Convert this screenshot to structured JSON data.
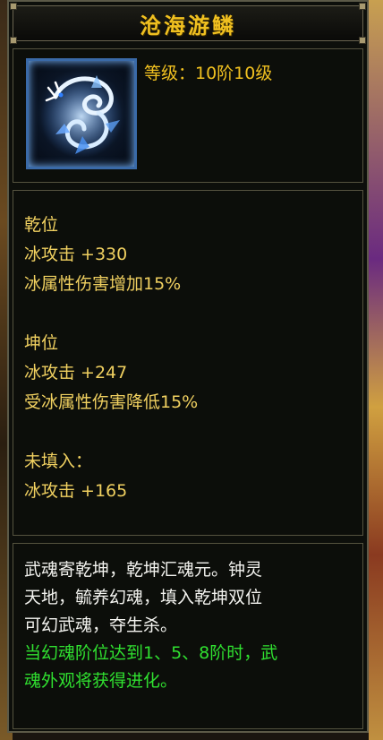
{
  "item": {
    "name": "沧海游鳞",
    "level_label": "等级：10阶10级",
    "icon": "ice-dragon-icon"
  },
  "stats": {
    "qian": {
      "heading": "乾位",
      "lines": [
        "冰攻击 +330",
        "冰属性伤害增加15%"
      ]
    },
    "kun": {
      "heading": "坤位",
      "lines": [
        "冰攻击 +247",
        "受冰属性伤害降低15%"
      ]
    },
    "unfilled": {
      "heading": "未填入：",
      "lines": [
        "冰攻击 +165"
      ]
    }
  },
  "description": {
    "white_lines": [
      "武魂寄乾坤，乾坤汇魂元。钟灵",
      "天地，毓养幻魂，填入乾坤双位",
      "可幻武魂，夺生杀。"
    ],
    "green_lines": [
      "当幻魂阶位达到1、5、8阶时，武",
      "魂外观将获得进化。"
    ]
  },
  "colors": {
    "title": "#f0c020",
    "stat_text": "#f0d060",
    "desc_text": "#f4f4f0",
    "desc_highlight": "#30e030",
    "border": "#55533f",
    "icon_border": "#3a6aa8"
  }
}
